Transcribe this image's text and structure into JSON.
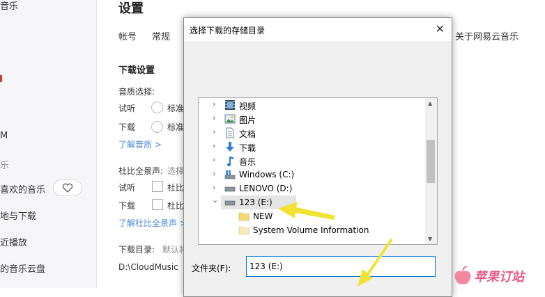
{
  "sidebar": {
    "items": [
      {
        "label": "音乐"
      },
      {
        "label": "M"
      },
      {
        "label": "乐"
      },
      {
        "label": "喜欢的音乐"
      },
      {
        "label": "地与下载"
      },
      {
        "label": "近播放"
      },
      {
        "label": "的音乐云盘"
      }
    ]
  },
  "settings": {
    "title": "设置",
    "tabs": [
      "帐号",
      "常规",
      "关于网易云音乐"
    ],
    "download_section": {
      "title": "下载设置",
      "quality_label": "音质选择:",
      "listen_label": "试听",
      "listen_option": "标准",
      "download_label": "下载",
      "download_option": "标准",
      "quality_link": "了解音质 >",
      "dolby_label": "杜比全景声:",
      "dolby_hint": "选择",
      "dolby_listen": "试听",
      "dolby_listen_option": "杜比",
      "dolby_download": "下载",
      "dolby_download_option": "杜比",
      "dolby_link": "了解杜比全景声 >",
      "dir_label": "下载目录:",
      "dir_hint": "默认将",
      "dir_path": "D:\\CloudMusic"
    }
  },
  "dialog": {
    "title": "选择下载的存储目录",
    "close_glyph": "✕",
    "tree": [
      {
        "label": "视频",
        "icon": "video-folder-icon",
        "chevron": "›"
      },
      {
        "label": "图片",
        "icon": "pictures-folder-icon",
        "chevron": "›"
      },
      {
        "label": "文档",
        "icon": "documents-folder-icon",
        "chevron": "›"
      },
      {
        "label": "下载",
        "icon": "downloads-folder-icon",
        "chevron": "›"
      },
      {
        "label": "音乐",
        "icon": "music-folder-icon",
        "chevron": "›"
      },
      {
        "label": "Windows (C:)",
        "icon": "windows-drive-icon",
        "chevron": "›"
      },
      {
        "label": "LENOVO (D:)",
        "icon": "drive-icon",
        "chevron": "›"
      },
      {
        "label": "123 (E:)",
        "icon": "drive-icon",
        "chevron": "⌄"
      },
      {
        "label": "NEW",
        "icon": "folder-icon",
        "chevron": ""
      },
      {
        "label": "System Volume Information",
        "icon": "folder-icon",
        "chevron": ""
      }
    ],
    "folder_label": "文件夹(F):",
    "folder_value": "123 (E:)"
  },
  "watermark": {
    "text": "苹果订站"
  },
  "colors": {
    "accent": "#0078d7",
    "arrow": "#f2e233",
    "link": "#4a8ad6",
    "brand_red": "#d33a31"
  }
}
